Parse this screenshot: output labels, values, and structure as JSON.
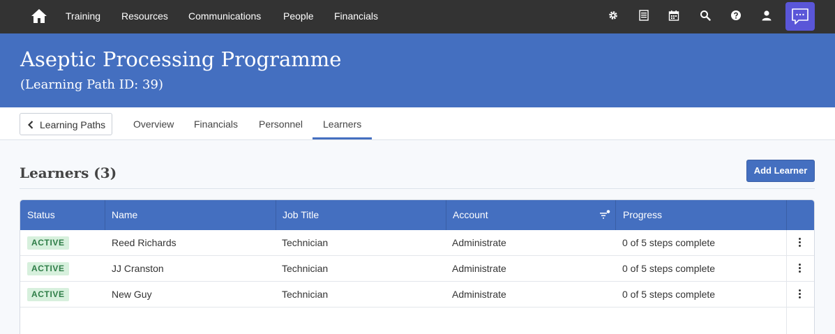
{
  "nav": {
    "home_icon": "home-icon",
    "links": [
      "Training",
      "Resources",
      "Communications",
      "People",
      "Financials"
    ],
    "icons": [
      "gear-icon",
      "list-icon",
      "calendar-icon",
      "search-icon",
      "help-icon",
      "user-icon"
    ],
    "chat_icon": "chat-icon"
  },
  "banner": {
    "title": "Aseptic Processing Programme",
    "subtitle": "(Learning Path ID: 39)"
  },
  "tabs": {
    "back_label": "Learning Paths",
    "items": [
      "Overview",
      "Financials",
      "Personnel",
      "Learners"
    ],
    "active": "Learners"
  },
  "section": {
    "title": "Learners (3)",
    "add_label": "Add Learner"
  },
  "table": {
    "columns": [
      "Status",
      "Name",
      "Job Title",
      "Account",
      "Progress"
    ],
    "rows": [
      {
        "status": "ACTIVE",
        "name": "Reed Richards",
        "job": "Technician",
        "account": "Administrate",
        "progress": "0 of 5 steps complete"
      },
      {
        "status": "ACTIVE",
        "name": "JJ Cranston",
        "job": "Technician",
        "account": "Administrate",
        "progress": "0 of 5 steps complete"
      },
      {
        "status": "ACTIVE",
        "name": "New Guy",
        "job": "Technician",
        "account": "Administrate",
        "progress": "0 of 5 steps complete"
      }
    ]
  },
  "colors": {
    "nav_bg": "#333333",
    "brand_blue": "#446fc0",
    "chat_purple": "#5a56d8",
    "badge_bg": "#d7f0dd",
    "badge_text": "#2e7d47"
  }
}
